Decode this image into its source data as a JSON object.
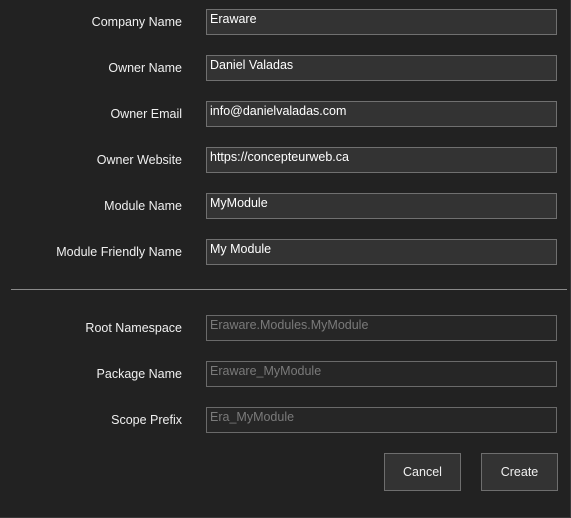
{
  "form": {
    "company_name": {
      "label": "Company Name",
      "value": "Eraware"
    },
    "owner_name": {
      "label": "Owner Name",
      "value": "Daniel Valadas"
    },
    "owner_email": {
      "label": "Owner Email",
      "value": "info@danielvaladas.com"
    },
    "owner_website": {
      "label": "Owner Website",
      "value": "https://concepteurweb.ca"
    },
    "module_name": {
      "label": "Module Name",
      "value": "MyModule"
    },
    "module_friendly_name": {
      "label": "Module Friendly Name",
      "value": "My Module"
    }
  },
  "generated": {
    "root_namespace": {
      "label": "Root Namespace",
      "value": "Eraware.Modules.MyModule"
    },
    "package_name": {
      "label": "Package Name",
      "value": "Eraware_MyModule"
    },
    "scope_prefix": {
      "label": "Scope Prefix",
      "value": "Era_MyModule"
    }
  },
  "buttons": {
    "cancel": "Cancel",
    "create": "Create"
  },
  "colors": {
    "background": "#222222",
    "field_background": "#333333",
    "field_border": "#707070",
    "text": "#f0f0f0",
    "readonly_text": "#7a7a7a"
  }
}
